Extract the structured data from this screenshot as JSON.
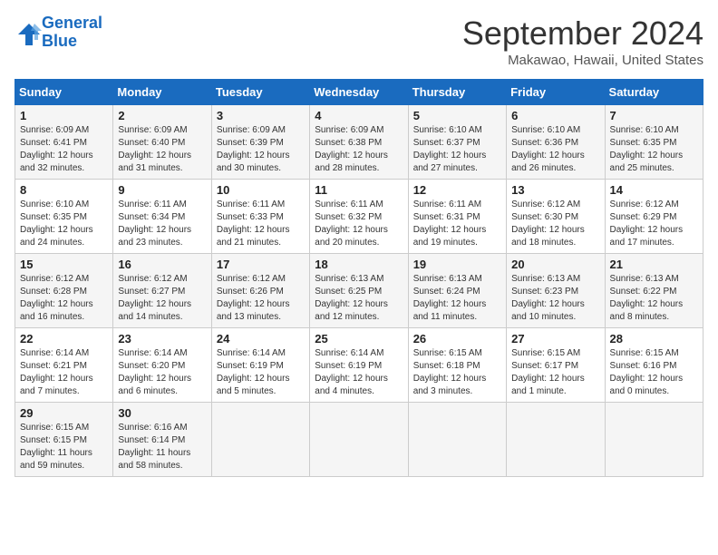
{
  "header": {
    "logo_line1": "General",
    "logo_line2": "Blue",
    "month_title": "September 2024",
    "location": "Makawao, Hawaii, United States"
  },
  "weekdays": [
    "Sunday",
    "Monday",
    "Tuesday",
    "Wednesday",
    "Thursday",
    "Friday",
    "Saturday"
  ],
  "weeks": [
    [
      {
        "day": "1",
        "rise": "6:09 AM",
        "set": "6:41 PM",
        "daylight": "12 hours and 32 minutes."
      },
      {
        "day": "2",
        "rise": "6:09 AM",
        "set": "6:40 PM",
        "daylight": "12 hours and 31 minutes."
      },
      {
        "day": "3",
        "rise": "6:09 AM",
        "set": "6:39 PM",
        "daylight": "12 hours and 30 minutes."
      },
      {
        "day": "4",
        "rise": "6:09 AM",
        "set": "6:38 PM",
        "daylight": "12 hours and 28 minutes."
      },
      {
        "day": "5",
        "rise": "6:10 AM",
        "set": "6:37 PM",
        "daylight": "12 hours and 27 minutes."
      },
      {
        "day": "6",
        "rise": "6:10 AM",
        "set": "6:36 PM",
        "daylight": "12 hours and 26 minutes."
      },
      {
        "day": "7",
        "rise": "6:10 AM",
        "set": "6:35 PM",
        "daylight": "12 hours and 25 minutes."
      }
    ],
    [
      {
        "day": "8",
        "rise": "6:10 AM",
        "set": "6:35 PM",
        "daylight": "12 hours and 24 minutes."
      },
      {
        "day": "9",
        "rise": "6:11 AM",
        "set": "6:34 PM",
        "daylight": "12 hours and 23 minutes."
      },
      {
        "day": "10",
        "rise": "6:11 AM",
        "set": "6:33 PM",
        "daylight": "12 hours and 21 minutes."
      },
      {
        "day": "11",
        "rise": "6:11 AM",
        "set": "6:32 PM",
        "daylight": "12 hours and 20 minutes."
      },
      {
        "day": "12",
        "rise": "6:11 AM",
        "set": "6:31 PM",
        "daylight": "12 hours and 19 minutes."
      },
      {
        "day": "13",
        "rise": "6:12 AM",
        "set": "6:30 PM",
        "daylight": "12 hours and 18 minutes."
      },
      {
        "day": "14",
        "rise": "6:12 AM",
        "set": "6:29 PM",
        "daylight": "12 hours and 17 minutes."
      }
    ],
    [
      {
        "day": "15",
        "rise": "6:12 AM",
        "set": "6:28 PM",
        "daylight": "12 hours and 16 minutes."
      },
      {
        "day": "16",
        "rise": "6:12 AM",
        "set": "6:27 PM",
        "daylight": "12 hours and 14 minutes."
      },
      {
        "day": "17",
        "rise": "6:12 AM",
        "set": "6:26 PM",
        "daylight": "12 hours and 13 minutes."
      },
      {
        "day": "18",
        "rise": "6:13 AM",
        "set": "6:25 PM",
        "daylight": "12 hours and 12 minutes."
      },
      {
        "day": "19",
        "rise": "6:13 AM",
        "set": "6:24 PM",
        "daylight": "12 hours and 11 minutes."
      },
      {
        "day": "20",
        "rise": "6:13 AM",
        "set": "6:23 PM",
        "daylight": "12 hours and 10 minutes."
      },
      {
        "day": "21",
        "rise": "6:13 AM",
        "set": "6:22 PM",
        "daylight": "12 hours and 8 minutes."
      }
    ],
    [
      {
        "day": "22",
        "rise": "6:14 AM",
        "set": "6:21 PM",
        "daylight": "12 hours and 7 minutes."
      },
      {
        "day": "23",
        "rise": "6:14 AM",
        "set": "6:20 PM",
        "daylight": "12 hours and 6 minutes."
      },
      {
        "day": "24",
        "rise": "6:14 AM",
        "set": "6:19 PM",
        "daylight": "12 hours and 5 minutes."
      },
      {
        "day": "25",
        "rise": "6:14 AM",
        "set": "6:19 PM",
        "daylight": "12 hours and 4 minutes."
      },
      {
        "day": "26",
        "rise": "6:15 AM",
        "set": "6:18 PM",
        "daylight": "12 hours and 3 minutes."
      },
      {
        "day": "27",
        "rise": "6:15 AM",
        "set": "6:17 PM",
        "daylight": "12 hours and 1 minute."
      },
      {
        "day": "28",
        "rise": "6:15 AM",
        "set": "6:16 PM",
        "daylight": "12 hours and 0 minutes."
      }
    ],
    [
      {
        "day": "29",
        "rise": "6:15 AM",
        "set": "6:15 PM",
        "daylight": "11 hours and 59 minutes."
      },
      {
        "day": "30",
        "rise": "6:16 AM",
        "set": "6:14 PM",
        "daylight": "11 hours and 58 minutes."
      },
      null,
      null,
      null,
      null,
      null
    ]
  ]
}
